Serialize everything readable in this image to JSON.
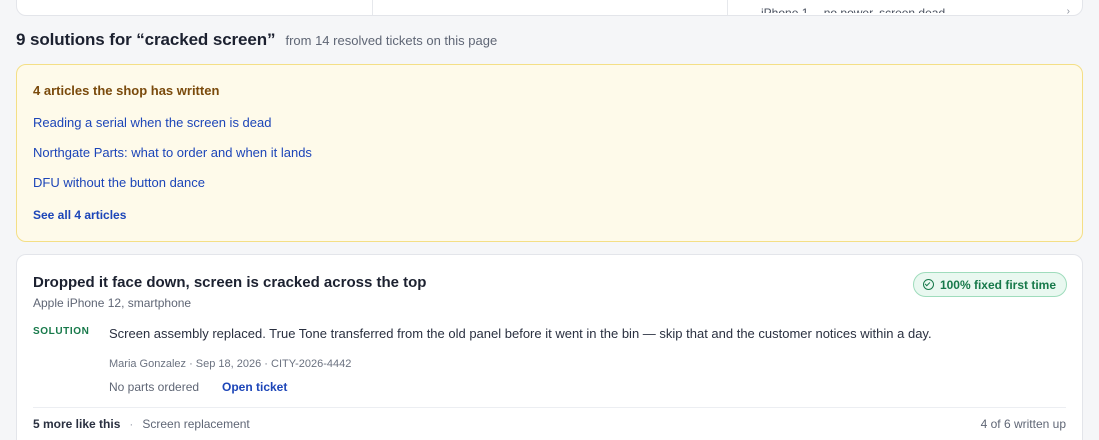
{
  "top_card": {
    "clipped_text": "iPhone 1… no power, screen dead",
    "chevron": "›"
  },
  "results": {
    "title": "9 solutions for “cracked screen”",
    "subtitle": "from 14 resolved tickets on this page"
  },
  "articles": {
    "heading": "4 articles the shop has written",
    "items": [
      {
        "label": "Reading a serial when the screen is dead"
      },
      {
        "label": "Northgate Parts: what to order and when it lands"
      },
      {
        "label": "DFU without the button dance"
      }
    ],
    "see_all": "See all 4 articles"
  },
  "ticket": {
    "title": "Dropped it face down, screen is cracked across the top",
    "device": "Apple iPhone 12, smartphone",
    "badge": {
      "label": "100% fixed first time",
      "icon": "check-circle-icon"
    },
    "solution_label": "SOLUTION",
    "solution_text": "Screen assembly replaced. True Tone transferred from the old panel before it went in the bin — skip that and the customer notices within a day.",
    "meta": "Maria Gonzalez · Sep 18, 2026 · CITY-2026-4442",
    "parts": "No parts ordered",
    "open_ticket": "Open ticket",
    "footer": {
      "more_like": "5 more like this",
      "separator": "·",
      "category": "Screen replacement",
      "written_up": "4 of 6 written up"
    }
  },
  "colors": {
    "accent_link": "#1c45b8",
    "success": "#17794a",
    "articles_bg": "#fefaea",
    "articles_border": "#f4df86"
  }
}
